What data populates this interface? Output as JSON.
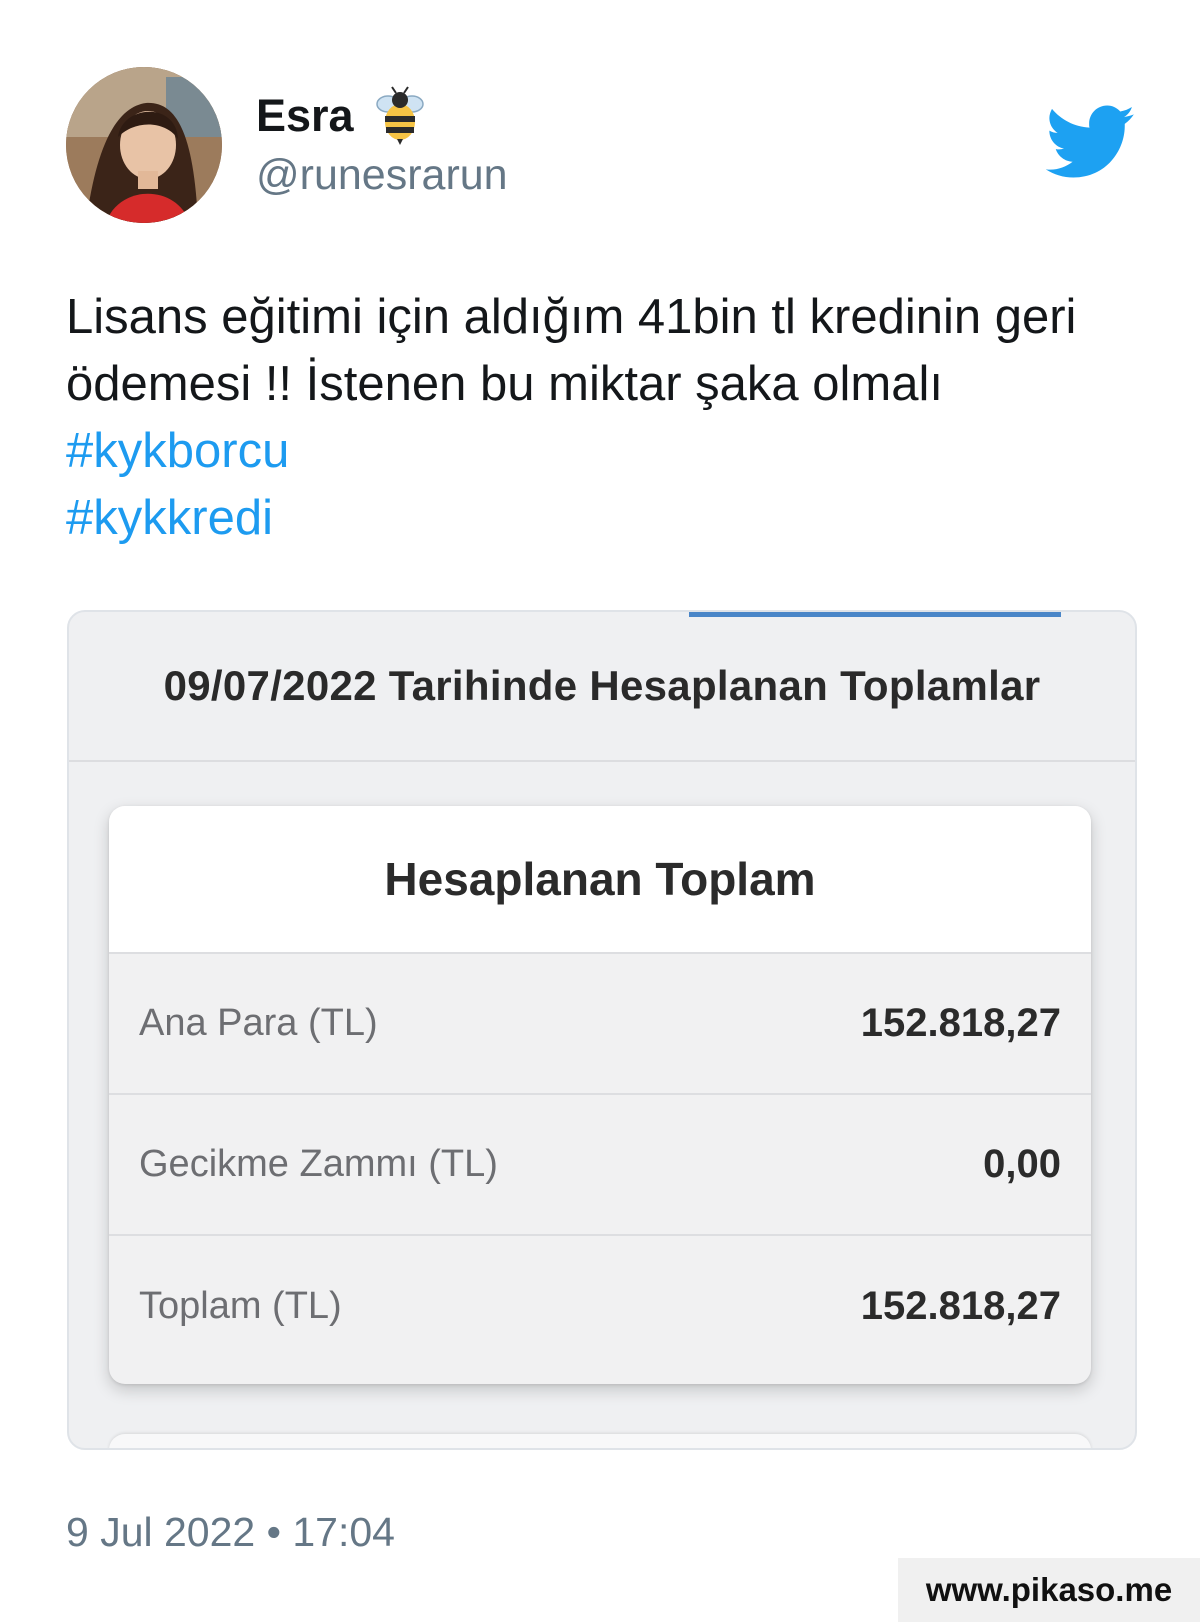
{
  "tweet": {
    "author": {
      "display_name": "Esra",
      "handle": "@runesrarun",
      "name_emoji_icon": "bee-icon"
    },
    "platform_icon": "twitter-bird-icon",
    "text_lines": [
      "Lisans eğitimi için aldığım 41bin tl kredinin geri",
      "ödemesi !! İstenen bu miktar şaka olmalı"
    ],
    "hashtags": [
      "#kykborcu",
      "#kykkredi"
    ],
    "timestamp": "9 Jul 2022 • 17:04"
  },
  "media": {
    "header_title": "09/07/2022 Tarihinde Hesaplanan Toplamlar",
    "card": {
      "title": "Hesaplanan Toplam",
      "rows": [
        {
          "label": "Ana Para (TL)",
          "value": "152.818,27"
        },
        {
          "label": "Gecikme Zammı (TL)",
          "value": "0,00"
        },
        {
          "label": "Toplam (TL)",
          "value": "152.818,27"
        }
      ]
    }
  },
  "watermark": "www.pikaso.me",
  "colors": {
    "hashtag": "#1d9bf0",
    "twitter_blue": "#1da1f2",
    "muted_text": "#657786",
    "tab_accent": "#4a86c8"
  }
}
